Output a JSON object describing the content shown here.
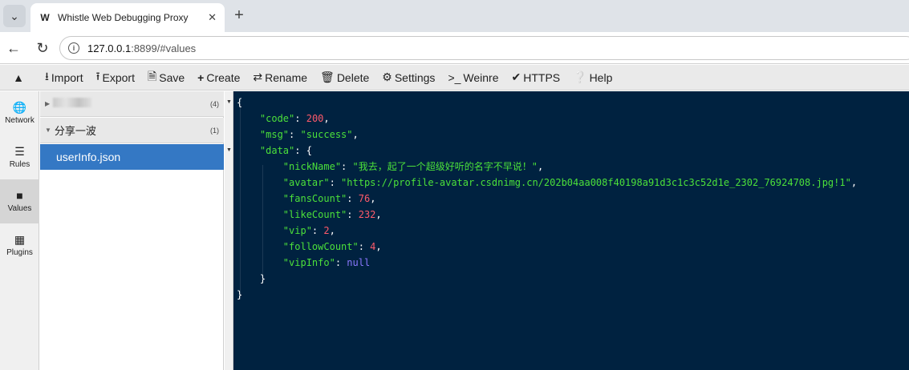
{
  "browser": {
    "tab_title": "Whistle Web Debugging Proxy",
    "tab_favicon": "W",
    "url_host": "127.0.0.1",
    "url_rest": ":8899/#values"
  },
  "toolbar": {
    "import": "Import",
    "export": "Export",
    "save": "Save",
    "create": "Create",
    "rename": "Rename",
    "delete": "Delete",
    "settings": "Settings",
    "weinre": "Weinre",
    "https": "HTTPS",
    "help": "Help"
  },
  "sidenav": {
    "network": "Network",
    "rules": "Rules",
    "values": "Values",
    "plugins": "Plugins"
  },
  "values_list": {
    "group1_count": "(4)",
    "group2_name": "分享一波",
    "group2_count": "(1)",
    "selected_file": "userInfo.json"
  },
  "json": {
    "code_key": "\"code\"",
    "code_val": "200",
    "msg_key": "\"msg\"",
    "msg_val": "\"success\"",
    "data_key": "\"data\"",
    "nick_key": "\"nickName\"",
    "nick_val": "\"我去，起了一个超级好听的名字不早说！\"",
    "avatar_key": "\"avatar\"",
    "avatar_val": "\"https://profile-avatar.csdnimg.cn/202b04aa008f40198a91d3c1c3c52d1e_2302_76924708.jpg!1\"",
    "fans_key": "\"fansCount\"",
    "fans_val": "76",
    "like_key": "\"likeCount\"",
    "like_val": "232",
    "vip_key": "\"vip\"",
    "vip_val": "2",
    "follow_key": "\"followCount\"",
    "follow_val": "4",
    "vipinfo_key": "\"vipInfo\"",
    "vipinfo_val": "null"
  },
  "colors": {
    "editor_bg": "#002240",
    "selected_row": "#3478c4",
    "string_green": "#4be03a",
    "number_red": "#ff5a6a",
    "null_purple": "#8a78ff"
  }
}
